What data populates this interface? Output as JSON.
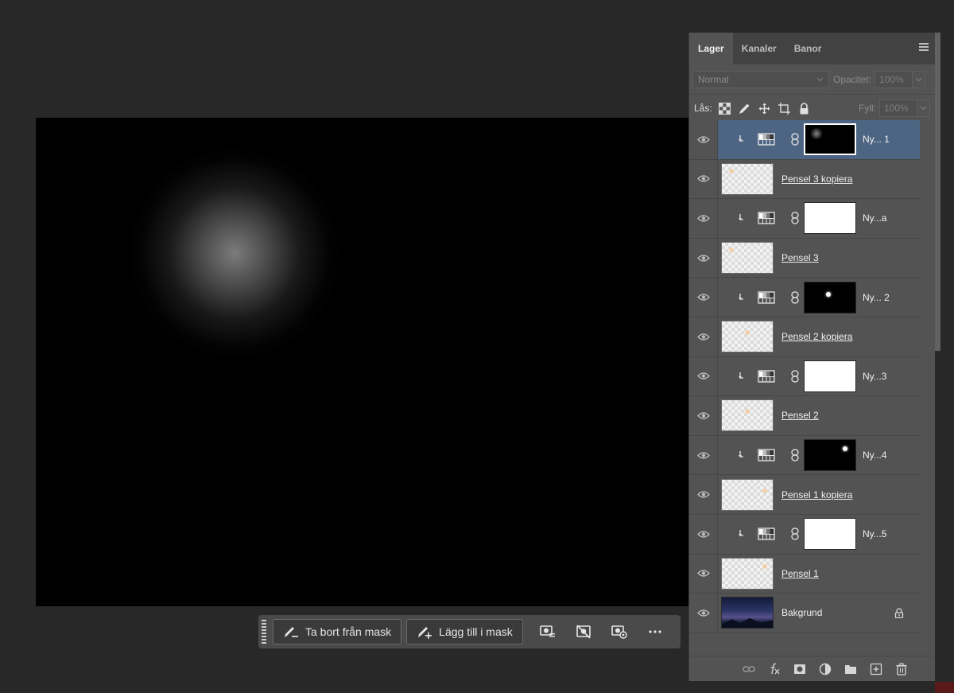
{
  "panel": {
    "tabs": [
      {
        "label": "Lager",
        "active": true
      },
      {
        "label": "Kanaler",
        "active": false
      },
      {
        "label": "Banor",
        "active": false
      }
    ],
    "blend_mode": "Normal",
    "opacity_label": "Opacitet:",
    "opacity_value": "100%",
    "lock_label": "Lås:",
    "fill_label": "Fyll:",
    "fill_value": "100%"
  },
  "layers": [
    {
      "type": "adjustment",
      "name": "Ny... 1",
      "mask": "black",
      "mask_dot": "soft",
      "selected": true
    },
    {
      "type": "pixel",
      "name": "Pensel 3 kopiera"
    },
    {
      "type": "adjustment",
      "name": "Ny...a",
      "mask": "white"
    },
    {
      "type": "pixel",
      "name": "Pensel 3"
    },
    {
      "type": "adjustment",
      "name": "Ny... 2",
      "mask": "black",
      "mask_dot": "center"
    },
    {
      "type": "pixel",
      "name": "Pensel 2 kopiera"
    },
    {
      "type": "adjustment",
      "name": "Ny...3",
      "mask": "white"
    },
    {
      "type": "pixel",
      "name": "Pensel 2"
    },
    {
      "type": "adjustment",
      "name": "Ny...4",
      "mask": "black",
      "mask_dot": "right"
    },
    {
      "type": "pixel",
      "name": "Pensel 1 kopiera"
    },
    {
      "type": "adjustment",
      "name": "Ny...5",
      "mask": "white"
    },
    {
      "type": "pixel",
      "name": "Pensel 1"
    },
    {
      "type": "background",
      "name": "Bakgrund",
      "locked": true
    }
  ],
  "taskbar": {
    "subtract_label": "Ta bort från mask",
    "add_label": "Lägg till i mask"
  },
  "colors": {
    "panel_bg": "#535353",
    "selected_row": "#4d6582",
    "canvas_bg": "#000000",
    "app_bg": "#282828"
  }
}
